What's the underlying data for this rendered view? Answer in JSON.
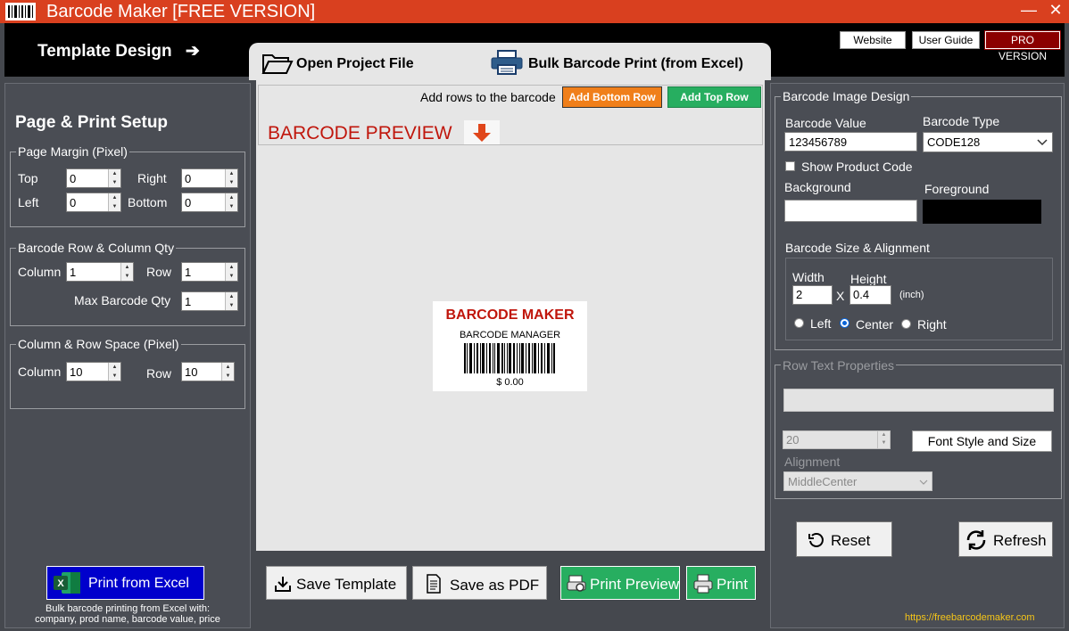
{
  "window": {
    "title": "Barcode Maker [FREE VERSION]",
    "minimize": "—",
    "close": "✕"
  },
  "header": {
    "template_design": "Template Design",
    "arrow": "➔",
    "website": "Website",
    "user_guide": "User Guide",
    "pro_version": "PRO VERSION"
  },
  "tabs": {
    "open_project": "Open Project File",
    "bulk_print": "Bulk Barcode Print (from Excel)"
  },
  "left": {
    "title": "Page & Print Setup",
    "margin_group": "Page Margin (Pixel)",
    "top_label": "Top",
    "top_value": "0",
    "right_label": "Right",
    "right_value": "0",
    "left_label": "Left",
    "left_value": "0",
    "bottom_label": "Bottom",
    "bottom_value": "0",
    "rowcol_group": "Barcode Row & Column Qty",
    "column_label": "Column",
    "column_value": "1",
    "row_label": "Row",
    "row_value": "1",
    "maxqty_label": "Max Barcode Qty",
    "maxqty_value": "1",
    "space_group": "Column & Row Space (Pixel)",
    "space_column_label": "Column",
    "space_column_value": "10",
    "space_row_label": "Row",
    "space_row_value": "10",
    "print_excel": "Print from Excel",
    "note_line1": "Bulk barcode printing from Excel with:",
    "note_line2": "company, prod name, barcode value, price"
  },
  "preview": {
    "add_rows_text": "Add rows to the barcode",
    "add_bottom_row": "Add Bottom Row",
    "add_top_row": "Add Top Row",
    "heading": "BARCODE PREVIEW",
    "label_title": "BARCODE MAKER",
    "label_subtitle": "BARCODE MANAGER",
    "label_price": "$ 0.00"
  },
  "bottom": {
    "save_template": "Save Template",
    "save_pdf": "Save as PDF",
    "print_preview": "Print Preview",
    "print": "Print"
  },
  "right": {
    "image_group": "Barcode Image Design",
    "value_label": "Barcode Value",
    "value": "123456789",
    "type_label": "Barcode Type",
    "type_value": "CODE128",
    "show_product_code": "Show Product Code",
    "background_label": "Background",
    "foreground_label": "Foreground",
    "size_group": "Barcode Size & Alignment",
    "width_label": "Width",
    "width_value": "2",
    "x_sep": "X",
    "height_label": "Height",
    "height_value": "0.4",
    "unit": "(inch)",
    "align_left": "Left",
    "align_center": "Center",
    "align_right": "Right",
    "row_text_group": "Row Text Properties",
    "font_size_value": "20",
    "font_style_button": "Font Style and Size",
    "alignment_label": "Alignment",
    "alignment_value": "MiddleCenter",
    "reset": "Reset",
    "refresh": "Refresh",
    "url": "https://freebarcodemaker.com"
  },
  "colors": {
    "titlebar": "#d9401f",
    "accent_red": "#c0160c",
    "green": "#27ae60",
    "orange": "#f07f1a",
    "excel_blue": "#0000cc"
  }
}
